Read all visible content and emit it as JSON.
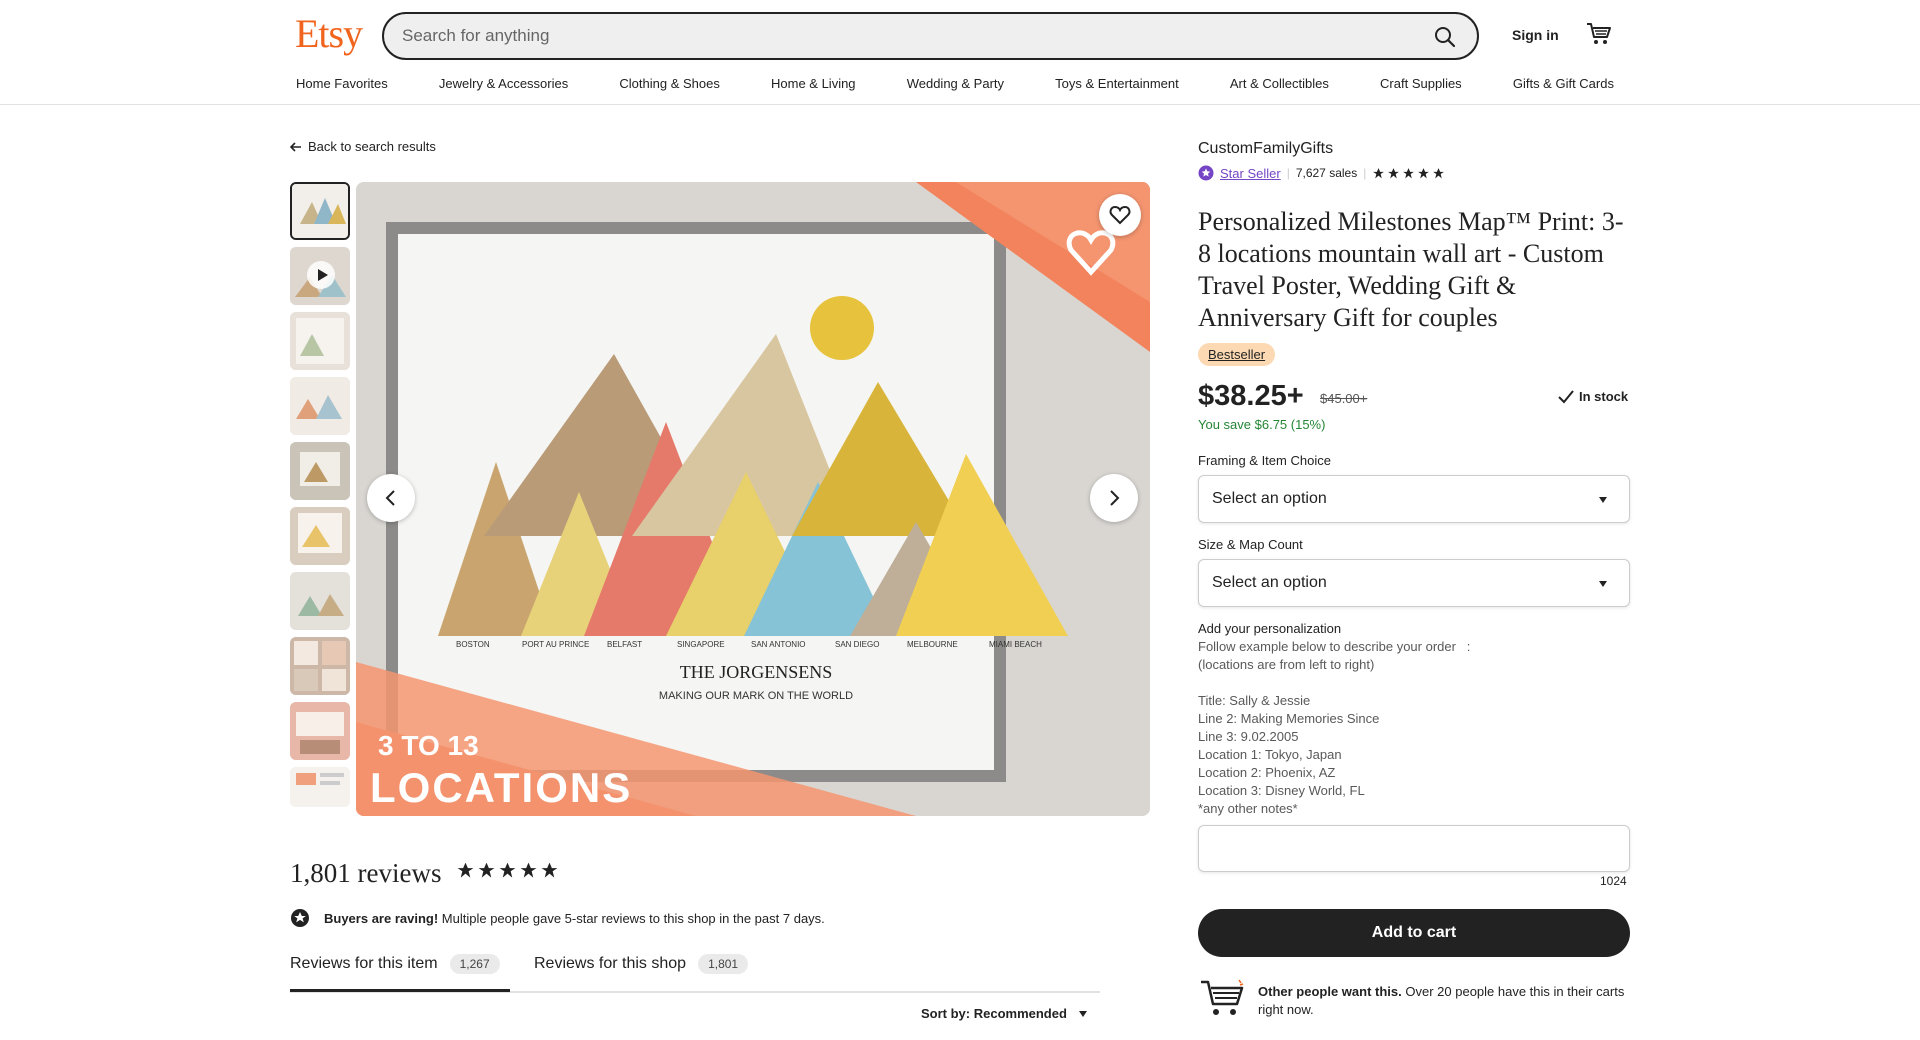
{
  "header": {
    "logo": "Etsy",
    "search_placeholder": "Search for anything",
    "sign_in": "Sign in",
    "nav": [
      "Home Favorites",
      "Jewelry & Accessories",
      "Clothing & Shoes",
      "Home & Living",
      "Wedding & Party",
      "Toys & Entertainment",
      "Art & Collectibles",
      "Craft Supplies",
      "Gifts & Gift Cards"
    ]
  },
  "gallery": {
    "back_link": "Back to search results",
    "image_text": {
      "locations": [
        "BOSTON",
        "PORT AU PRINCE",
        "BELFAST",
        "SINGAPORE",
        "SAN ANTONIO",
        "SAN DIEGO",
        "MELBOURNE",
        "MIAMI BEACH"
      ],
      "family": "THE JORGENSENS",
      "tagline": "MAKING OUR MARK ON THE WORLD",
      "banner_small": "3 TO 13",
      "banner_big": "LOCATIONS"
    }
  },
  "reviews": {
    "title": "1,801 reviews",
    "raving_bold": "Buyers are raving!",
    "raving_text": "Multiple people gave 5-star reviews to this shop in the past 7 days.",
    "tabs": [
      {
        "label": "Reviews for this item",
        "count": "1,267"
      },
      {
        "label": "Reviews for this shop",
        "count": "1,801"
      }
    ],
    "sort": "Sort by: Recommended"
  },
  "listing": {
    "shop_name": "CustomFamilyGifts",
    "star_seller": "Star Seller",
    "sales": "7,627 sales",
    "title": "Personalized Milestones Map™ Print: 3-8 locations mountain wall art - Custom Travel Poster, Wedding Gift & Anniversary Gift for couples",
    "bestseller": "Bestseller",
    "price": "$38.25+",
    "old_price": "$45.00+",
    "in_stock": "In stock",
    "savings": "You save $6.75 (15%)",
    "option1_label": "Framing & Item Choice",
    "option1_value": "Select an option",
    "option2_label": "Size & Map Count",
    "option2_value": "Select an option",
    "personalization_label": "Add your personalization",
    "personalization_lines": [
      "Follow example below to describe your order   :",
      "(locations are from left to right)",
      "",
      "Title: Sally & Jessie",
      "Line 2: Making Memories Since",
      "Line 3: 9.02.2005",
      "Location 1: Tokyo, Japan",
      "Location 2: Phoenix, AZ",
      "Location 3: Disney World, FL",
      "*any other notes*"
    ],
    "char_count": "1024",
    "add_to_cart": "Add to cart",
    "others_bold": "Other people want this.",
    "others_text": "Over 20 people have this in their carts right now."
  },
  "colors": {
    "brand": "#F1641E",
    "savings": "#258635",
    "star_seller": "#7445c4",
    "bestseller_bg": "#fcd9b2"
  }
}
